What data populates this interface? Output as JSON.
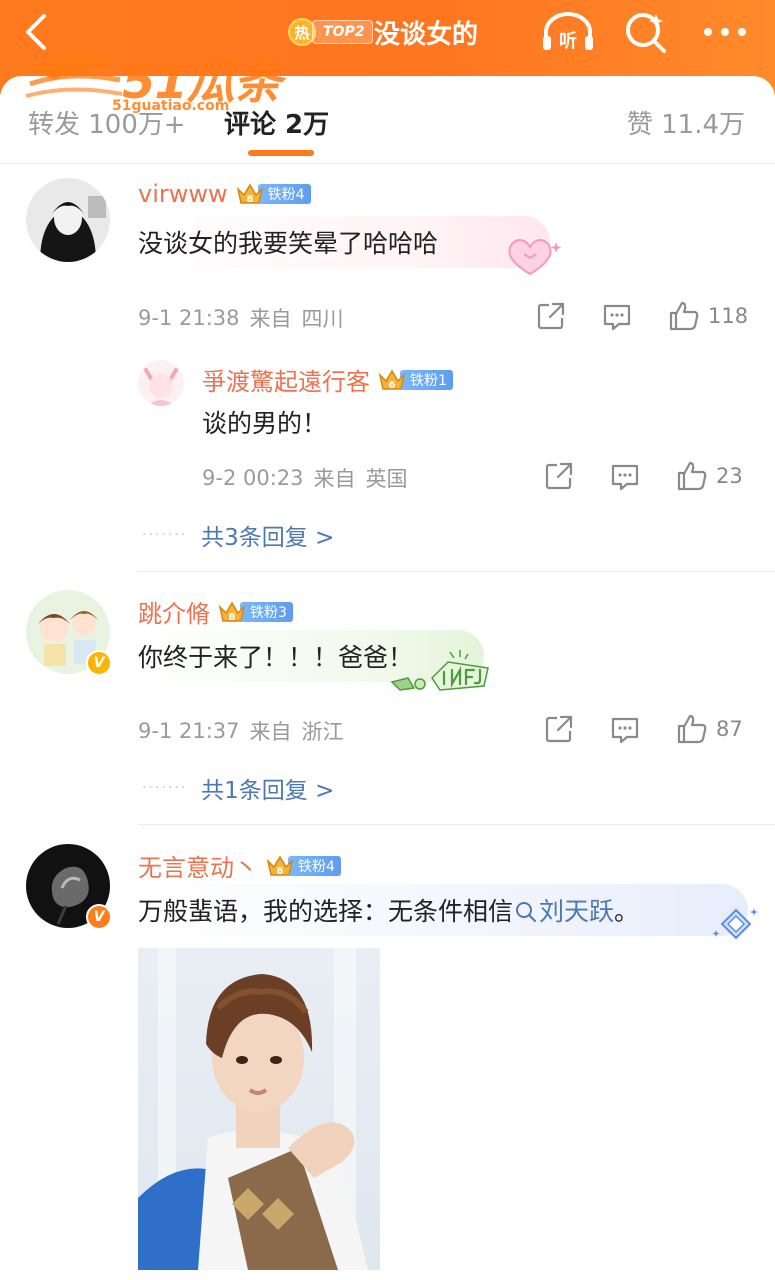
{
  "header": {
    "hot_badge": "热",
    "rank_tag": "TOP2",
    "topic_title": "没谈女的",
    "listen_label": "听",
    "watermark_text": "51瓜条",
    "watermark_url": "51guatiao.com"
  },
  "tabs": {
    "repost": "转发 100万+",
    "comment": "评论 2万",
    "like": "赞 11.4万"
  },
  "comments": [
    {
      "username": "virwww",
      "fan_label": "铁粉4",
      "fan_level": "8",
      "text": "没谈女的我要笑晕了哈哈哈",
      "date": "9-1 21:38",
      "from": "来自",
      "location": "四川",
      "likes": "118",
      "reply": {
        "username": "爭渡驚起遠行客",
        "fan_label": "铁粉1",
        "fan_level": "6",
        "text": "谈的男的！",
        "date": "9-2 00:23",
        "from": "来自",
        "location": "英国",
        "likes": "23"
      },
      "more_replies": "共3条回复 >"
    },
    {
      "username": "跳介脩",
      "fan_label": "铁粉3",
      "fan_level": "8",
      "text": "你终于来了！！！爸爸！",
      "date": "9-1 21:37",
      "from": "来自",
      "location": "浙江",
      "likes": "87",
      "more_replies": "共1条回复 >"
    },
    {
      "username": "无言意动丶",
      "fan_label": "铁粉4",
      "fan_level": "8",
      "text_before": "万般蜚语，我的选择：无条件相信",
      "topic": "刘天跃",
      "text_after": "。"
    }
  ],
  "colors": {
    "accent": "#ff7a1c",
    "username": "#eb7350",
    "link": "#4c78b4",
    "meta": "#9a9a9a"
  }
}
